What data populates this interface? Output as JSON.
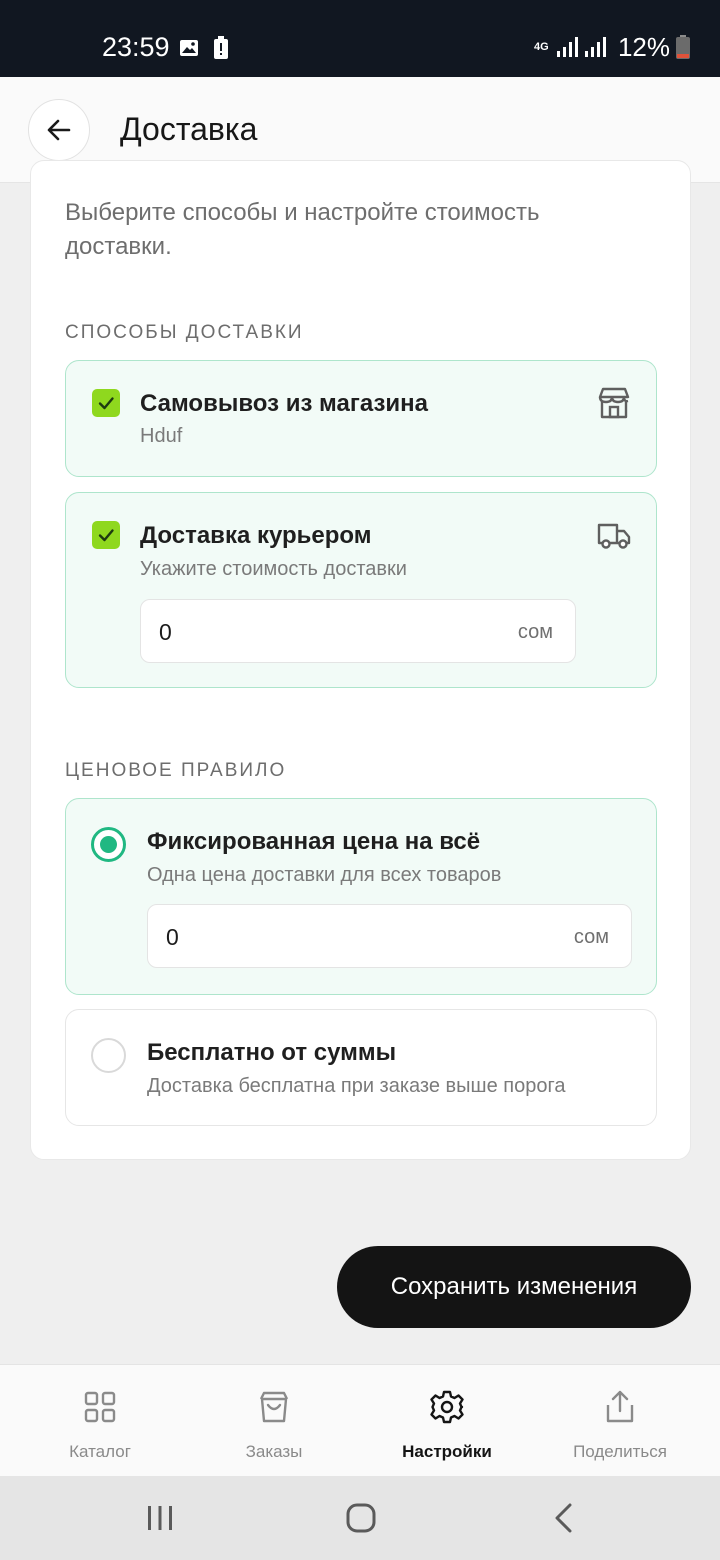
{
  "status_bar": {
    "time": "23:59",
    "network": "4G",
    "battery_pct": "12%",
    "icons": [
      "image-icon",
      "alert-icon",
      "signal-icon",
      "signal-icon",
      "battery-icon"
    ]
  },
  "header": {
    "title": "Доставка",
    "back_icon": "arrow-left-icon"
  },
  "intro": "Выберите способы и настройте стоимость доставки.",
  "delivery_methods": {
    "label": "СПОСОБЫ ДОСТАВКИ",
    "items": [
      {
        "title": "Самовывоз из магазина",
        "subtitle": "Hduf",
        "checked": true,
        "icon": "store-icon"
      },
      {
        "title": "Доставка курьером",
        "subtitle": "Укажите стоимость доставки",
        "checked": true,
        "icon": "truck-icon",
        "price_value": "0",
        "price_unit": "сом"
      }
    ]
  },
  "pricing_rule": {
    "label": "ЦЕНОВОЕ ПРАВИЛО",
    "options": [
      {
        "title": "Фиксированная цена на всё",
        "subtitle": "Одна цена доставки для всех товаров",
        "selected": true,
        "price_value": "0",
        "price_unit": "сом"
      },
      {
        "title": "Бесплатно от суммы",
        "subtitle": "Доставка бесплатна при заказе выше порога",
        "selected": false
      }
    ]
  },
  "save_button": "Сохранить изменения",
  "bottom_nav": {
    "items": [
      {
        "label": "Каталог",
        "icon": "grid-icon",
        "active": false
      },
      {
        "label": "Заказы",
        "icon": "bag-icon",
        "active": false
      },
      {
        "label": "Настройки",
        "icon": "gear-icon",
        "active": true
      },
      {
        "label": "Поделиться",
        "icon": "share-icon",
        "active": false
      }
    ]
  },
  "colors": {
    "accent_green": "#20b882",
    "checkbox_green": "#8fd81e",
    "selected_bg": "#f2fbf7",
    "primary_button": "#141414",
    "status_bar_bg": "#111721"
  }
}
